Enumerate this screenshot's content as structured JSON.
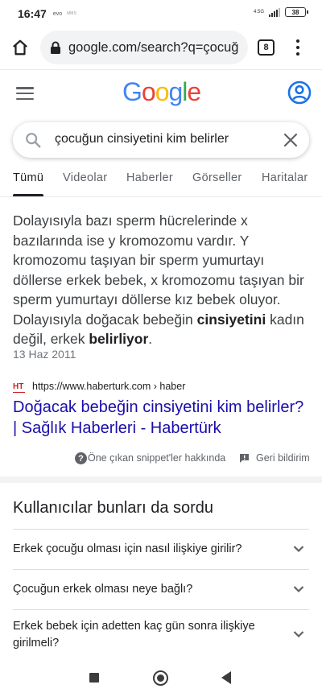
{
  "status_bar": {
    "time": "16:47",
    "carrier": "evo",
    "carrier_small": "MMS",
    "network": "4.5G",
    "battery": "38"
  },
  "browser": {
    "url": "google.com/search?q=çocuğ",
    "tab_count": "8"
  },
  "google": {
    "logo_letters": [
      {
        "ch": "G",
        "color": "#4285F4"
      },
      {
        "ch": "o",
        "color": "#EA4335"
      },
      {
        "ch": "o",
        "color": "#FBBC05"
      },
      {
        "ch": "g",
        "color": "#4285F4"
      },
      {
        "ch": "l",
        "color": "#34A853"
      },
      {
        "ch": "e",
        "color": "#EA4335"
      }
    ]
  },
  "search": {
    "query": "çocuğun cinsiyetini kim belirler"
  },
  "tabs": [
    {
      "label": "Tümü",
      "active": true
    },
    {
      "label": "Videolar"
    },
    {
      "label": "Haberler"
    },
    {
      "label": "Görseller"
    },
    {
      "label": "Haritalar"
    }
  ],
  "featured_snippet": {
    "text_1": "Dolayısıyla bazı sperm hücrelerinde x bazılarında ise y kromozomu vardır. Y kromozomu taşıyan bir sperm yumurtayı döllerse erkek bebek, x kromozomu taşıyan bir sperm yumurtayı döllerse kız bebek oluyor. Dolayısıyla doğacak bebeğin ",
    "bold_1": "cinsiyetini",
    "text_2": " kadın değil, erkek ",
    "bold_2": "belirliyor",
    "text_3": ".",
    "date": "13 Haz 2011",
    "favicon_text": "HT",
    "source_url": "https://www.haberturk.com › haber",
    "title": "Doğacak bebeğin cinsiyetini kim belirler? | Sağlık Haberleri - Habertürk",
    "about_label": "Öne çıkan snippet'ler hakkında",
    "feedback_label": "Geri bildirim"
  },
  "people_also_ask": {
    "title": "Kullanıcılar bunları da sordu",
    "questions": [
      "Erkek çocuğu olması için nasıl ilişkiye girilir?",
      "Çocuğun erkek olması neye bağlı?",
      "Erkek bebek için adetten kaç gün sonra ilişkiye girilmeli?"
    ]
  },
  "colors": {
    "link": "#1a0dab",
    "account_icon": "#1a73e8",
    "favicon": "#c81d25"
  },
  "icons": [
    "home-icon",
    "lock-icon",
    "tabs-count-icon",
    "overflow-menu-icon",
    "hamburger-menu-icon",
    "account-icon",
    "search-icon",
    "clear-icon",
    "help-icon",
    "feedback-icon",
    "chevron-down-icon",
    "recents-icon",
    "home-nav-icon",
    "back-icon"
  ]
}
